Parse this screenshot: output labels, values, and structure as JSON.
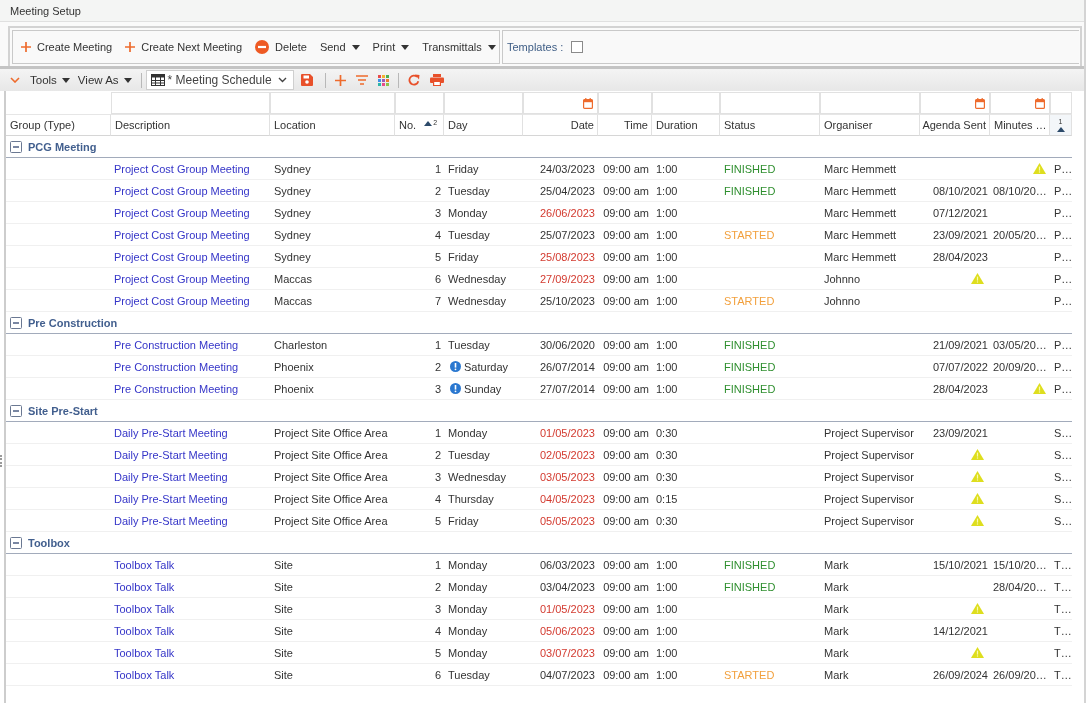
{
  "window": {
    "title": "Meeting Setup"
  },
  "toolbar": {
    "buttons": [
      {
        "label": "Create Meeting",
        "kind": "add"
      },
      {
        "label": "Create Next Meeting",
        "kind": "add"
      },
      {
        "label": "Delete",
        "kind": "delete"
      },
      {
        "label": "Send",
        "kind": "menu"
      },
      {
        "label": "Print",
        "kind": "menu"
      },
      {
        "label": "Transmittals",
        "kind": "menu"
      }
    ],
    "templates": {
      "label": "Templates :",
      "checked": false
    }
  },
  "view_bar": {
    "menus": [
      {
        "label": "Tools"
      },
      {
        "label": "View As"
      }
    ],
    "view_select": {
      "value": "* Meeting Schedule"
    }
  },
  "grid": {
    "columns": [
      {
        "label": "Group (Type)",
        "filter": false,
        "calendar": false,
        "sorted_ascending": false
      },
      {
        "label": "Description",
        "filter": true,
        "calendar": false,
        "sorted_ascending": false
      },
      {
        "label": "Location",
        "filter": true,
        "calendar": false,
        "sorted_ascending": false
      },
      {
        "label": "No.",
        "filter": true,
        "calendar": false,
        "sorted_ascending": true,
        "sort_order": "2"
      },
      {
        "label": "Day",
        "filter": true,
        "calendar": false,
        "sorted_ascending": false
      },
      {
        "label": "Date",
        "filter": true,
        "calendar": true,
        "sorted_ascending": false
      },
      {
        "label": "Time",
        "filter": true,
        "calendar": false,
        "sorted_ascending": false
      },
      {
        "label": "Duration",
        "filter": true,
        "calendar": false,
        "sorted_ascending": false
      },
      {
        "label": "Status",
        "filter": true,
        "calendar": false,
        "sorted_ascending": false
      },
      {
        "label": "Organiser",
        "filter": true,
        "calendar": false,
        "sorted_ascending": false
      },
      {
        "label": "Agenda Sent",
        "filter": true,
        "calendar": true,
        "sorted_ascending": false
      },
      {
        "label": "Minutes …",
        "filter": true,
        "calendar": true,
        "sorted_ascending": false
      },
      {
        "filter": true,
        "calendar": false,
        "sorted_ascending": true,
        "sort_order": "1"
      }
    ],
    "groups": [
      {
        "name": "PCG Meeting",
        "expanded": true,
        "rows": [
          {
            "description": "Project Cost Group Meeting",
            "location": "Sydney",
            "no": "1",
            "day": "Friday",
            "day_info": false,
            "date": "24/03/2023",
            "date_overdue": false,
            "time": "09:00 am",
            "duration": "1:00",
            "status": {
              "text": "FINISHED",
              "color": "#2f8f2f"
            },
            "organiser": "Marc Hemmett",
            "agenda_warning": false,
            "minutes_warning": true,
            "column_13": "P…"
          },
          {
            "description": "Project Cost Group Meeting",
            "location": "Sydney",
            "no": "2",
            "day": "Tuesday",
            "day_info": false,
            "date": "25/04/2023",
            "date_overdue": false,
            "time": "09:00 am",
            "duration": "1:00",
            "status": {
              "text": "FINISHED",
              "color": "#2f8f2f"
            },
            "organiser": "Marc Hemmett",
            "agenda_sent": "08/10/2021",
            "agenda_warning": false,
            "minutes": "08/10/20…",
            "minutes_warning": false,
            "column_13": "P…"
          },
          {
            "description": "Project Cost Group Meeting",
            "location": "Sydney",
            "no": "3",
            "day": "Monday",
            "day_info": false,
            "date": "26/06/2023",
            "date_overdue": true,
            "time": "09:00 am",
            "duration": "1:00",
            "organiser": "Marc Hemmett",
            "agenda_sent": "07/12/2021",
            "agenda_warning": false,
            "minutes_warning": false,
            "column_13": "P…"
          },
          {
            "description": "Project Cost Group Meeting",
            "location": "Sydney",
            "no": "4",
            "day": "Tuesday",
            "day_info": false,
            "date": "25/07/2023",
            "date_overdue": false,
            "time": "09:00 am",
            "duration": "1:00",
            "status": {
              "text": "STARTED",
              "color": "#f2a03d"
            },
            "organiser": "Marc Hemmett",
            "agenda_sent": "23/09/2021",
            "agenda_warning": false,
            "minutes": "20/05/20…",
            "minutes_warning": false,
            "column_13": "P…"
          },
          {
            "description": "Project Cost Group Meeting",
            "location": "Sydney",
            "no": "5",
            "day": "Friday",
            "day_info": false,
            "date": "25/08/2023",
            "date_overdue": true,
            "time": "09:00 am",
            "duration": "1:00",
            "organiser": "Marc Hemmett",
            "agenda_sent": "28/04/2023",
            "agenda_warning": false,
            "minutes_warning": false,
            "column_13": "P…"
          },
          {
            "description": "Project Cost Group Meeting",
            "location": "Maccas",
            "no": "6",
            "day": "Wednesday",
            "day_info": false,
            "date": "27/09/2023",
            "date_overdue": true,
            "time": "09:00 am",
            "duration": "1:00",
            "organiser": "Johnno",
            "agenda_warning": true,
            "minutes_warning": false,
            "column_13": "P…"
          },
          {
            "description": "Project Cost Group Meeting",
            "location": "Maccas",
            "no": "7",
            "day": "Wednesday",
            "day_info": false,
            "date": "25/10/2023",
            "date_overdue": false,
            "time": "09:00 am",
            "duration": "1:00",
            "status": {
              "text": "STARTED",
              "color": "#f2a03d"
            },
            "organiser": "Johnno",
            "agenda_warning": false,
            "minutes_warning": false,
            "column_13": "P…"
          }
        ]
      },
      {
        "name": "Pre Construction",
        "expanded": true,
        "rows": [
          {
            "description": "Pre Construction Meeting",
            "location": "Charleston",
            "no": "1",
            "day": "Tuesday",
            "day_info": false,
            "date": "30/06/2020",
            "date_overdue": false,
            "time": "09:00 am",
            "duration": "1:00",
            "status": {
              "text": "FINISHED",
              "color": "#2f8f2f"
            },
            "agenda_sent": "21/09/2021",
            "agenda_warning": false,
            "minutes": "03/05/20…",
            "minutes_warning": false,
            "column_13": "P…"
          },
          {
            "description": "Pre Construction Meeting",
            "location": "Phoenix",
            "no": "2",
            "day": "Saturday",
            "day_info": true,
            "date": "26/07/2014",
            "date_overdue": false,
            "time": "09:00 am",
            "duration": "1:00",
            "status": {
              "text": "FINISHED",
              "color": "#2f8f2f"
            },
            "agenda_sent": "07/07/2022",
            "agenda_warning": false,
            "minutes": "20/09/20…",
            "minutes_warning": false,
            "column_13": "P…"
          },
          {
            "description": "Pre Construction Meeting",
            "location": "Phoenix",
            "no": "3",
            "day": "Sunday",
            "day_info": true,
            "date": "27/07/2014",
            "date_overdue": false,
            "time": "09:00 am",
            "duration": "1:00",
            "status": {
              "text": "FINISHED",
              "color": "#2f8f2f"
            },
            "agenda_sent": "28/04/2023",
            "agenda_warning": false,
            "minutes_warning": true,
            "column_13": "P…"
          }
        ]
      },
      {
        "name": "Site Pre-Start",
        "expanded": true,
        "rows": [
          {
            "description": "Daily Pre-Start Meeting",
            "location": "Project Site Office Area",
            "no": "1",
            "day": "Monday",
            "day_info": false,
            "date": "01/05/2023",
            "date_overdue": true,
            "time": "09:00 am",
            "duration": "0:30",
            "organiser": "Project Supervisor",
            "agenda_sent": "23/09/2021",
            "agenda_warning": false,
            "minutes_warning": false,
            "column_13": "S…"
          },
          {
            "description": "Daily Pre-Start Meeting",
            "location": "Project Site Office Area",
            "no": "2",
            "day": "Tuesday",
            "day_info": false,
            "date": "02/05/2023",
            "date_overdue": true,
            "time": "09:00 am",
            "duration": "0:30",
            "organiser": "Project Supervisor",
            "agenda_warning": true,
            "minutes_warning": false,
            "column_13": "S…"
          },
          {
            "description": "Daily Pre-Start Meeting",
            "location": "Project Site Office Area",
            "no": "3",
            "day": "Wednesday",
            "day_info": false,
            "date": "03/05/2023",
            "date_overdue": true,
            "time": "09:00 am",
            "duration": "0:30",
            "organiser": "Project Supervisor",
            "agenda_warning": true,
            "minutes_warning": false,
            "column_13": "S…"
          },
          {
            "description": "Daily Pre-Start Meeting",
            "location": "Project Site Office Area",
            "no": "4",
            "day": "Thursday",
            "day_info": false,
            "date": "04/05/2023",
            "date_overdue": true,
            "time": "09:00 am",
            "duration": "0:15",
            "organiser": "Project Supervisor",
            "agenda_warning": true,
            "minutes_warning": false,
            "column_13": "S…"
          },
          {
            "description": "Daily Pre-Start Meeting",
            "location": "Project Site Office Area",
            "no": "5",
            "day": "Friday",
            "day_info": false,
            "date": "05/05/2023",
            "date_overdue": true,
            "time": "09:00 am",
            "duration": "0:30",
            "organiser": "Project Supervisor",
            "agenda_warning": true,
            "minutes_warning": false,
            "column_13": "S…"
          }
        ]
      },
      {
        "name": "Toolbox",
        "expanded": true,
        "rows": [
          {
            "description": "Toolbox Talk",
            "location": "Site",
            "no": "1",
            "day": "Monday",
            "day_info": false,
            "date": "06/03/2023",
            "date_overdue": false,
            "time": "09:00 am",
            "duration": "1:00",
            "status": {
              "text": "FINISHED",
              "color": "#2f8f2f"
            },
            "organiser": "Mark",
            "agenda_sent": "15/10/2021",
            "agenda_warning": false,
            "minutes": "15/10/20…",
            "minutes_warning": false,
            "column_13": "T…"
          },
          {
            "description": "Toolbox Talk",
            "location": "Site",
            "no": "2",
            "day": "Monday",
            "day_info": false,
            "date": "03/04/2023",
            "date_overdue": false,
            "time": "09:00 am",
            "duration": "1:00",
            "status": {
              "text": "FINISHED",
              "color": "#2f8f2f"
            },
            "organiser": "Mark",
            "agenda_warning": false,
            "minutes": "28/04/20…",
            "minutes_warning": false,
            "column_13": "T…"
          },
          {
            "description": "Toolbox Talk",
            "location": "Site",
            "no": "3",
            "day": "Monday",
            "day_info": false,
            "date": "01/05/2023",
            "date_overdue": true,
            "time": "09:00 am",
            "duration": "1:00",
            "organiser": "Mark",
            "agenda_warning": true,
            "minutes_warning": false,
            "column_13": "T…"
          },
          {
            "description": "Toolbox Talk",
            "location": "Site",
            "no": "4",
            "day": "Monday",
            "day_info": false,
            "date": "05/06/2023",
            "date_overdue": true,
            "time": "09:00 am",
            "duration": "1:00",
            "organiser": "Mark",
            "agenda_sent": "14/12/2021",
            "agenda_warning": false,
            "minutes_warning": false,
            "column_13": "T…"
          },
          {
            "description": "Toolbox Talk",
            "location": "Site",
            "no": "5",
            "day": "Monday",
            "day_info": false,
            "date": "03/07/2023",
            "date_overdue": true,
            "time": "09:00 am",
            "duration": "1:00",
            "organiser": "Mark",
            "agenda_warning": true,
            "minutes_warning": false,
            "column_13": "T…"
          },
          {
            "description": "Toolbox Talk",
            "location": "Site",
            "no": "6",
            "day": "Tuesday",
            "day_info": false,
            "date": "04/07/2023",
            "date_overdue": false,
            "time": "09:00 am",
            "duration": "1:00",
            "status": {
              "text": "STARTED",
              "color": "#f2a03d"
            },
            "organiser": "Mark",
            "agenda_sent": "26/09/2024",
            "agenda_warning": false,
            "minutes": "26/09/20…",
            "minutes_warning": false,
            "column_13": "T…"
          }
        ]
      }
    ]
  }
}
